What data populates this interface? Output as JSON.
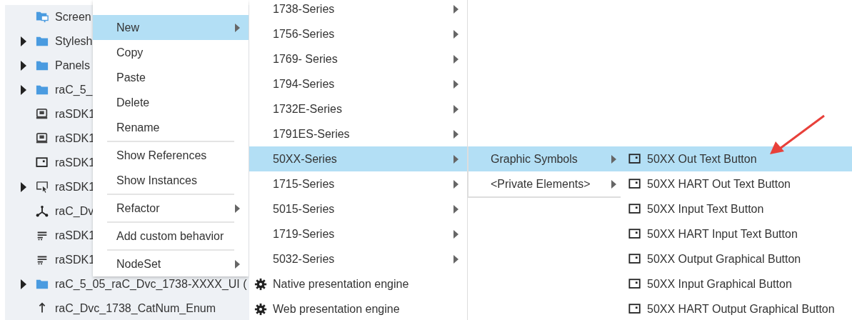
{
  "tree": {
    "items": [
      {
        "label": "Screen",
        "kind": "screen",
        "expandable": false
      },
      {
        "label": "Stylesh",
        "kind": "folder",
        "expandable": true
      },
      {
        "label": "Panels",
        "kind": "folder",
        "expandable": true
      },
      {
        "label": "raC_5_",
        "kind": "folder",
        "expandable": true
      },
      {
        "label": "raSDK1",
        "kind": "widget",
        "expandable": false
      },
      {
        "label": "raSDK1",
        "kind": "widget",
        "expandable": false
      },
      {
        "label": "raSDK1",
        "kind": "button",
        "expandable": false
      },
      {
        "label": "raSDK1",
        "kind": "cursor",
        "expandable": true
      },
      {
        "label": "raC_Dv",
        "kind": "network",
        "expandable": false
      },
      {
        "label": "raSDK1",
        "kind": "list",
        "expandable": false
      },
      {
        "label": "raSDK1",
        "kind": "list",
        "expandable": false
      },
      {
        "label": "raC_5_05_raC_Dvc_1738-XXXX_UI (",
        "kind": "folder",
        "expandable": true
      },
      {
        "label": "raC_Dvc_1738_CatNum_Enum",
        "kind": "enum",
        "expandable": false
      }
    ]
  },
  "context_menu": {
    "groups": [
      [
        {
          "label": "New",
          "selected": true,
          "submenu": true
        },
        {
          "label": "Copy",
          "selected": false,
          "submenu": false
        },
        {
          "label": "Paste",
          "selected": false,
          "submenu": false
        },
        {
          "label": "Delete",
          "selected": false,
          "submenu": false
        },
        {
          "label": "Rename",
          "selected": false,
          "submenu": false
        }
      ],
      [
        {
          "label": "Show References",
          "selected": false,
          "submenu": false
        },
        {
          "label": "Show Instances",
          "selected": false,
          "submenu": false
        }
      ],
      [
        {
          "label": "Refactor",
          "selected": false,
          "submenu": true
        }
      ],
      [
        {
          "label": "Add custom behavior",
          "selected": false,
          "submenu": false
        }
      ],
      [
        {
          "label": "NodeSet",
          "selected": false,
          "submenu": true
        }
      ]
    ]
  },
  "series_menu": {
    "items": [
      {
        "label": "1738-Series",
        "selected": false,
        "submenu": true
      },
      {
        "label": "1756-Series",
        "selected": false,
        "submenu": true
      },
      {
        "label": "1769- Series",
        "selected": false,
        "submenu": true
      },
      {
        "label": "1794-Series",
        "selected": false,
        "submenu": true
      },
      {
        "label": "1732E-Series",
        "selected": false,
        "submenu": true
      },
      {
        "label": "1791ES-Series",
        "selected": false,
        "submenu": true
      },
      {
        "label": "50XX-Series",
        "selected": true,
        "submenu": true
      },
      {
        "label": "1715-Series",
        "selected": false,
        "submenu": true
      },
      {
        "label": "5015-Series",
        "selected": false,
        "submenu": true
      },
      {
        "label": "1719-Series",
        "selected": false,
        "submenu": true
      },
      {
        "label": "5032-Series",
        "selected": false,
        "submenu": true
      },
      {
        "label": "Native presentation engine",
        "selected": false,
        "submenu": false,
        "kind": "gear"
      },
      {
        "label": "Web presentation engine",
        "selected": false,
        "submenu": false,
        "kind": "gear"
      }
    ]
  },
  "category_menu": {
    "items": [
      {
        "label": "Graphic Symbols",
        "selected": true,
        "submenu": true
      },
      {
        "label": "<Private Elements>",
        "selected": false,
        "submenu": true
      }
    ]
  },
  "symbol_menu": {
    "items": [
      {
        "label": "50XX Out Text Button",
        "selected": true,
        "kind": "button"
      },
      {
        "label": "50XX HART Out Text Button",
        "selected": false,
        "kind": "button"
      },
      {
        "label": "50XX Input Text Button",
        "selected": false,
        "kind": "button"
      },
      {
        "label": "50XX HART Input Text Button",
        "selected": false,
        "kind": "button"
      },
      {
        "label": "50XX Output Graphical Button",
        "selected": false,
        "kind": "button"
      },
      {
        "label": "50XX Input Graphical Button",
        "selected": false,
        "kind": "button"
      },
      {
        "label": "50XX HART Output Graphical Button",
        "selected": false,
        "kind": "button"
      }
    ]
  }
}
